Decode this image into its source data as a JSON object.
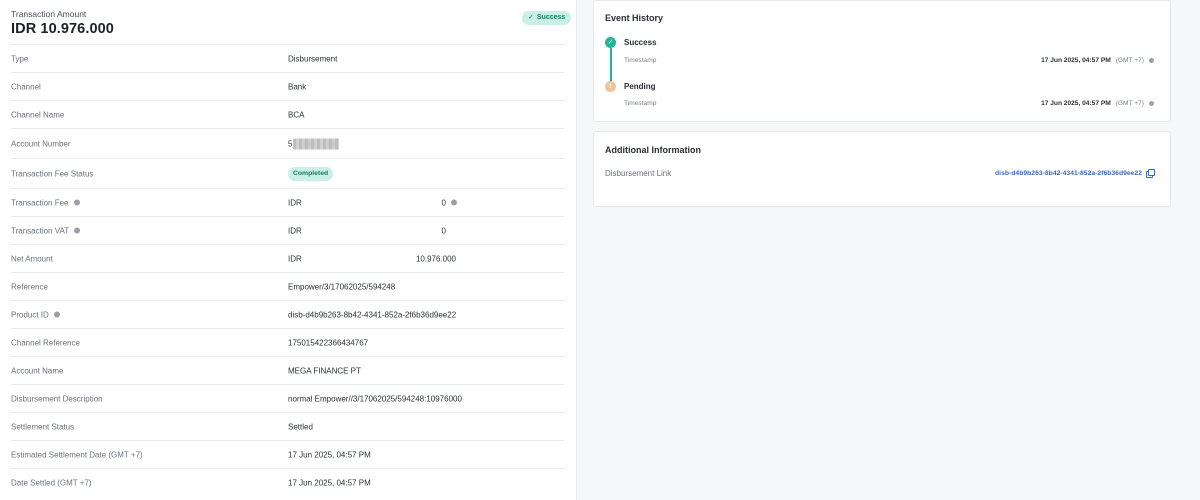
{
  "transaction": {
    "amount_label": "Transaction Amount",
    "amount_value": "IDR 10.976.000",
    "status_badge": "Success",
    "rows": [
      {
        "label": "Type",
        "value": "Disbursement"
      },
      {
        "label": "Channel",
        "value": "Bank"
      },
      {
        "label": "Channel Name",
        "value": "BCA"
      },
      {
        "label": "Account Number",
        "value": "5",
        "masked": true
      },
      {
        "label": "Transaction Fee Status",
        "value": "Completed"
      },
      {
        "label": "Transaction Fee",
        "currency": "IDR",
        "amount": "0"
      },
      {
        "label": "Transaction VAT",
        "currency": "IDR",
        "amount": "0"
      },
      {
        "label": "Net Amount",
        "currency": "IDR",
        "amount": "10.976.000"
      },
      {
        "label": "Reference",
        "value": "Empower/3/17062025/594248"
      },
      {
        "label": "Product ID",
        "value": "disb-d4b9b263-8b42-4341-852a-2f6b36d9ee22"
      },
      {
        "label": "Channel Reference",
        "value": "1750154223664347​67"
      },
      {
        "label": "Account Name",
        "value": "MEGA FINANCE PT"
      },
      {
        "label": "Disbursement Description",
        "value": "normal Empower//3/17062025/594248:10976000"
      },
      {
        "label": "Settlement Status",
        "value": "Settled"
      },
      {
        "label": "Estimated Settlement Date (GMT +7)",
        "value": "17 Jun 2025, 04:57 PM"
      },
      {
        "label": "Date Settled (GMT +7)",
        "value": "17 Jun 2025, 04:57 PM"
      }
    ]
  },
  "event_history": {
    "title": "Event History",
    "events": [
      {
        "status": "Success",
        "sub_label": "Timestamp",
        "time": "17 Jun 2025, 04:57 PM",
        "tz": "(GMT +7)"
      },
      {
        "status": "Pending",
        "sub_label": "Timestamp",
        "time": "17 Jun 2025, 04:57 PM",
        "tz": "(GMT +7)"
      }
    ]
  },
  "additional_info": {
    "title": "Additional Information",
    "link_label": "Disbursement Link",
    "link_value": "disb-d4b9b263-8b42-4341-852a-2f6b36d9ee22"
  },
  "colors": {
    "success_green": "#23b59a",
    "badge_bg": "#c9f0e6",
    "pending_orange": "#f0c39a",
    "link_blue": "#3c67c4"
  },
  "icons": [
    "check-icon",
    "info-icon",
    "copy-icon"
  ]
}
